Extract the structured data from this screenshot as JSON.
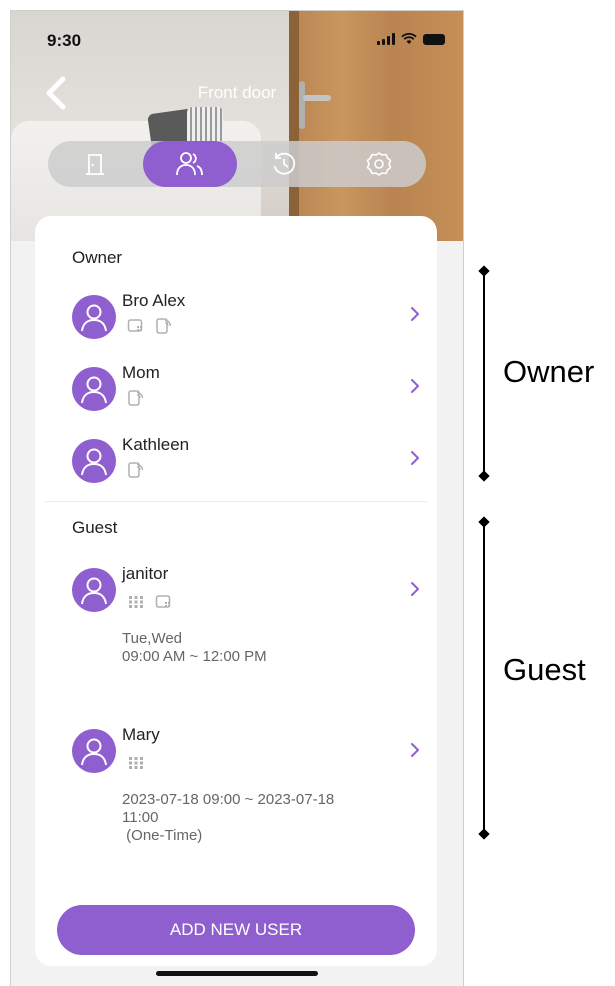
{
  "status_bar": {
    "time": "9:30"
  },
  "header": {
    "title": "Front door"
  },
  "tabs": [
    {
      "name": "door",
      "icon": "door-icon",
      "active": false
    },
    {
      "name": "users",
      "icon": "users-icon",
      "active": true
    },
    {
      "name": "history",
      "icon": "history-icon",
      "active": false
    },
    {
      "name": "settings",
      "icon": "gear-icon",
      "active": false
    }
  ],
  "owner_section": {
    "title": "Owner",
    "users": [
      {
        "name": "Bro Alex",
        "access_icons": [
          "card-icon",
          "phone-nfc-icon"
        ]
      },
      {
        "name": "Mom",
        "access_icons": [
          "phone-nfc-icon"
        ]
      },
      {
        "name": "Kathleen",
        "access_icons": [
          "phone-nfc-icon"
        ]
      }
    ]
  },
  "guest_section": {
    "title": "Guest",
    "users": [
      {
        "name": "janitor",
        "access_icons": [
          "keypad-icon",
          "card-icon"
        ],
        "schedule_line1": "Tue,Wed",
        "schedule_line2": "09:00 AM ~ 12:00 PM",
        "schedule_line3": ""
      },
      {
        "name": "Mary",
        "access_icons": [
          "keypad-icon"
        ],
        "schedule_line1": "2023-07-18 09:00 ~ 2023-07-18",
        "schedule_line2": "11:00",
        "schedule_line3": " (One-Time)"
      }
    ]
  },
  "add_button": {
    "label": "ADD NEW USER"
  },
  "annotations": {
    "owner_label": "Owner",
    "guest_label": "Guest"
  },
  "colors": {
    "accent": "#8f5fcf"
  }
}
